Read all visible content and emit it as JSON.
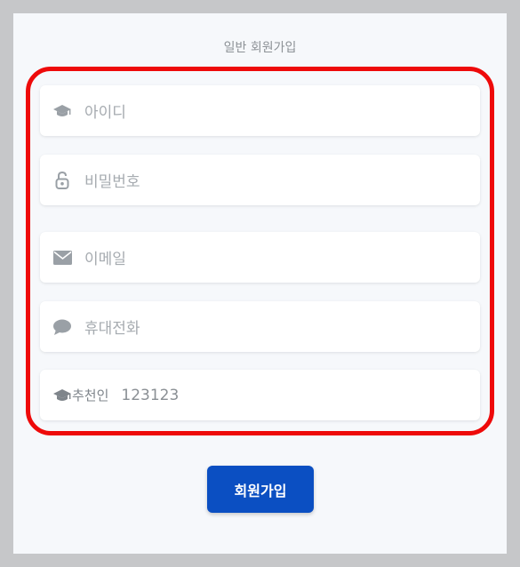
{
  "form": {
    "title": "일반 회원가입",
    "fields": [
      {
        "name": "id",
        "placeholder": "아이디",
        "icon": "graduation-cap-icon"
      },
      {
        "name": "password",
        "placeholder": "비밀번호",
        "icon": "unlock-icon"
      },
      {
        "name": "email",
        "placeholder": "이메일",
        "icon": "envelope-icon"
      },
      {
        "name": "phone",
        "placeholder": "휴대전화",
        "icon": "chat-bubble-icon"
      }
    ],
    "referrer": {
      "label": "추천인",
      "value": "123123",
      "icon": "graduation-cap-icon"
    },
    "submit_label": "회원가입"
  },
  "colors": {
    "highlight": "#ee0a0a",
    "button": "#0b4fc2",
    "icon": "#9aa0a6"
  }
}
